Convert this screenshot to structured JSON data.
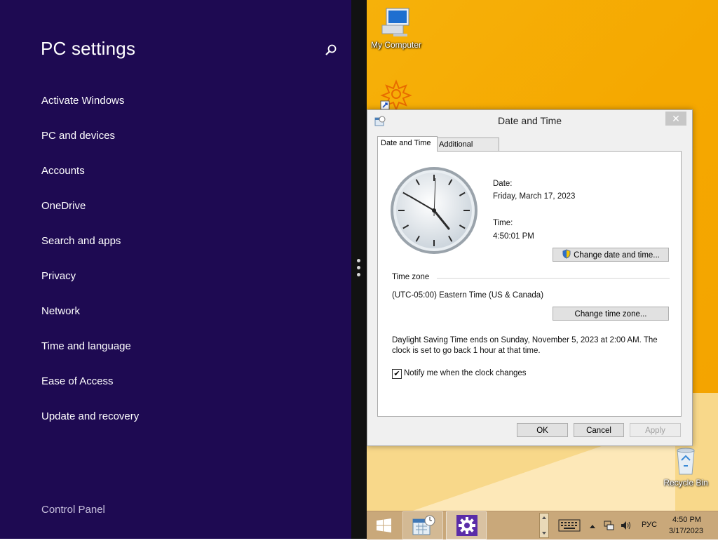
{
  "pc_settings": {
    "title": "PC settings",
    "menu": [
      {
        "label": "Activate Windows"
      },
      {
        "label": "PC and devices"
      },
      {
        "label": "Accounts"
      },
      {
        "label": "OneDrive"
      },
      {
        "label": "Search and apps"
      },
      {
        "label": "Privacy"
      },
      {
        "label": "Network"
      },
      {
        "label": "Time and language"
      },
      {
        "label": "Ease of Access"
      },
      {
        "label": "Update and recovery"
      }
    ],
    "control_panel": "Control Panel",
    "bg_color": "#1e0a52"
  },
  "desktop": {
    "icons": [
      {
        "label": "My Computer",
        "icon": "computer-icon"
      },
      {
        "label": "",
        "icon": "shortcut-flower-icon"
      },
      {
        "label": "Recycle Bin",
        "icon": "recycle-bin-icon"
      }
    ]
  },
  "dialog": {
    "title": "Date and Time",
    "tabs": [
      {
        "label": "Date and Time",
        "active": true
      },
      {
        "label": "Additional Clocks",
        "active": false
      }
    ],
    "date_label": "Date:",
    "date_value": "Friday, March 17, 2023",
    "time_label": "Time:",
    "time_value": "4:50:01 PM",
    "change_datetime_button": "Change date and time...",
    "timezone_heading": "Time zone",
    "timezone_value": "(UTC-05:00) Eastern Time (US & Canada)",
    "change_timezone_button": "Change time zone...",
    "dst_line1": "Daylight Saving Time ends on Sunday, November 5, 2023 at 2:00 AM. The",
    "dst_line2": "clock is set to go back 1 hour at that time.",
    "notify_checkbox": {
      "label": "Notify me when the clock changes",
      "checked": true
    },
    "ok_button": "OK",
    "cancel_button": "Cancel",
    "apply_button": "Apply",
    "close_glyph": "✕"
  },
  "taskbar": {
    "language": "РУС",
    "time": "4:50 PM",
    "date": "3/17/2023"
  }
}
